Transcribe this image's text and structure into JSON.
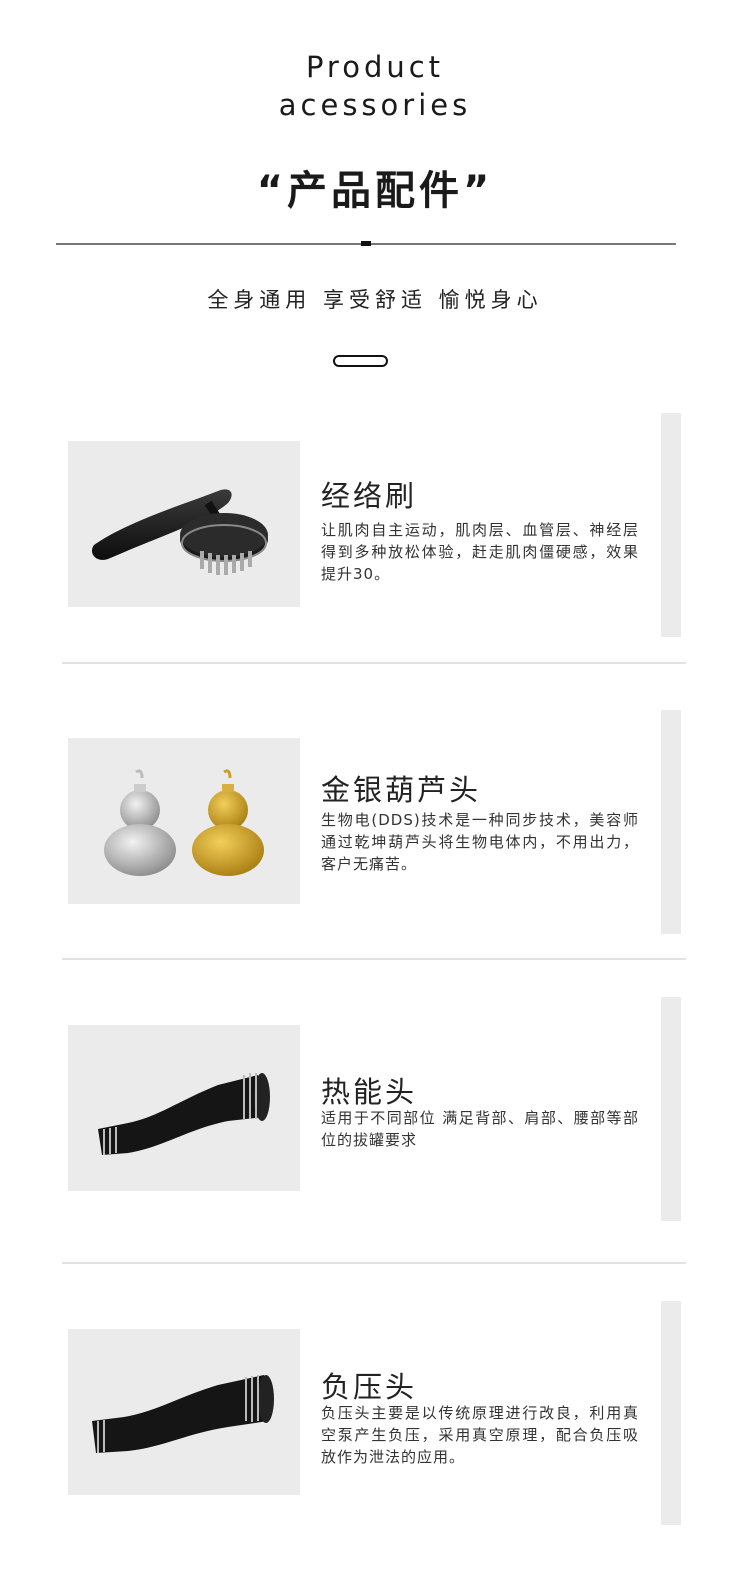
{
  "header": {
    "title_en_line1": "Product",
    "title_en_line2": "acessories",
    "title_cn": "“产品配件”",
    "subtitle": "全身通用 享受舒适 愉悦身心"
  },
  "items": [
    {
      "name": "经络刷",
      "desc": "让肌肉自主运动，肌肉层、血管层、神经层得到多种放松体验，赶走肌肉僵硬感，效果提升30。",
      "icon": "massage-brush-icon"
    },
    {
      "name": "金银葫芦头",
      "desc": "生物电(DDS)技术是一种同步技术，美容师通过乾坤葫芦头将生物电体内，不用出力，客户无痛苦。",
      "icon": "gourd-heads-icon"
    },
    {
      "name": "热能头",
      "desc": "适用于不同部位 满足背部、肩部、腰部等部位的拔罐要求",
      "icon": "thermal-head-icon"
    },
    {
      "name": "负压头",
      "desc": "负压头主要是以传统原理进行改良，利用真空泵产生负压，采用真空原理，配合负压吸放作为泄法的应用。",
      "icon": "negative-pressure-head-icon"
    }
  ]
}
